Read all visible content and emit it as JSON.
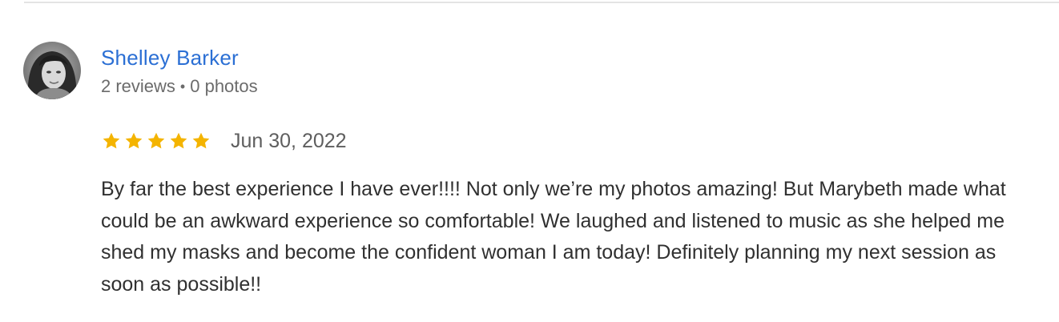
{
  "review": {
    "reviewer": {
      "name": "Shelley Barker",
      "reviews_count": "2 reviews",
      "separator": "•",
      "photos_count": "0 photos",
      "avatar": "profile-photo"
    },
    "rating": {
      "value": 5,
      "max": 5,
      "star_color": "#f4b400",
      "star_icon": "star-icon"
    },
    "date": "Jun 30, 2022",
    "text": "By far the best experience I have ever!!!! Not only we’re my photos amazing! But Marybeth made what could be an awkward experience so comfortable! We laughed and listened to music as she helped me shed my masks and become the confident woman I am today! Definitely planning my next session as soon as possible!!"
  },
  "colors": {
    "name_link": "#2b6fd4",
    "meta_text": "#6b6b6b",
    "body_text": "#303030",
    "divider": "#e4e4e4"
  }
}
